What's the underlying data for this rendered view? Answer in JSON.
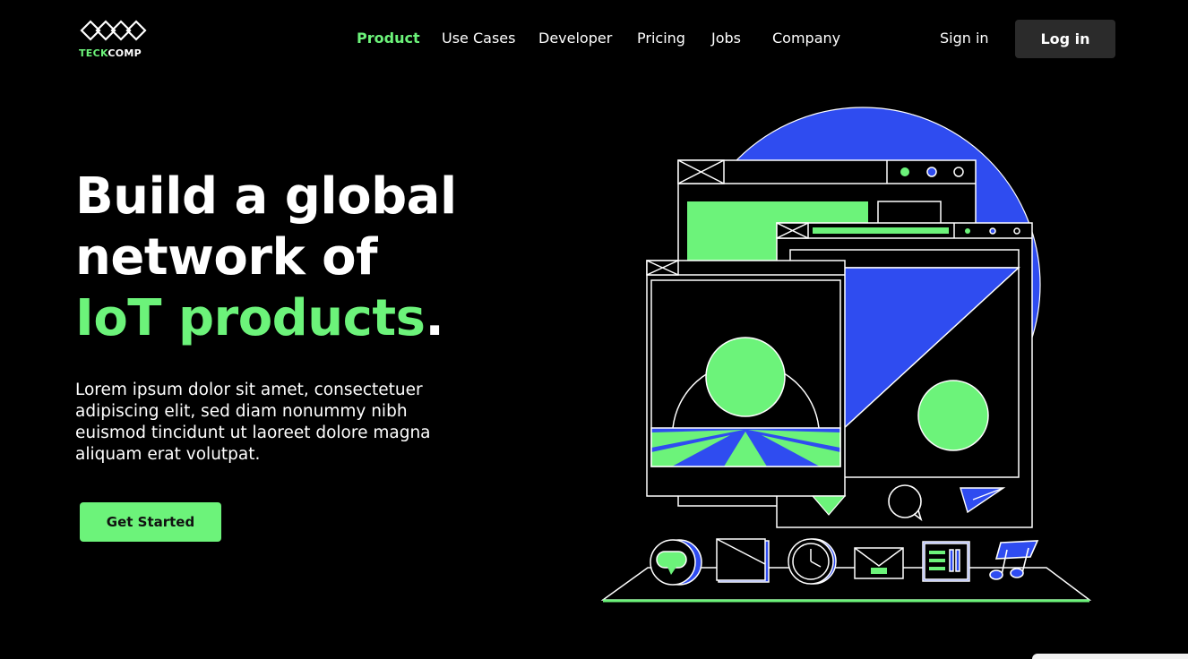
{
  "brand": {
    "name_part1": "TECK",
    "name_part2": "COMP",
    "accent_color": "#6cf37a",
    "blue_color": "#2f4cf0"
  },
  "nav": {
    "items": [
      {
        "label": "Product",
        "active": true
      },
      {
        "label": "Use Cases",
        "active": false
      },
      {
        "label": "Developer",
        "active": false
      },
      {
        "label": "Pricing",
        "active": false
      },
      {
        "label": "Jobs",
        "active": false
      },
      {
        "label": "Company",
        "active": false
      }
    ],
    "sign_in": "Sign in",
    "log_in": "Log in"
  },
  "hero": {
    "title_line1": "Build a global",
    "title_line2": "network of",
    "title_highlight": "IoT products",
    "title_period": ".",
    "description": "Lorem ipsum dolor sit amet, consectetuer adipiscing elit, sed diam nonummy nibh euismod tincidunt ut laoreet dolore magna aliquam erat volutpat.",
    "cta_label": "Get Started"
  },
  "illustration": {
    "icons": [
      "chat-bubble-icon",
      "picture-icon",
      "clock-icon",
      "mail-icon",
      "list-icon",
      "music-note-icon",
      "comment-icon",
      "paper-plane-icon"
    ]
  }
}
